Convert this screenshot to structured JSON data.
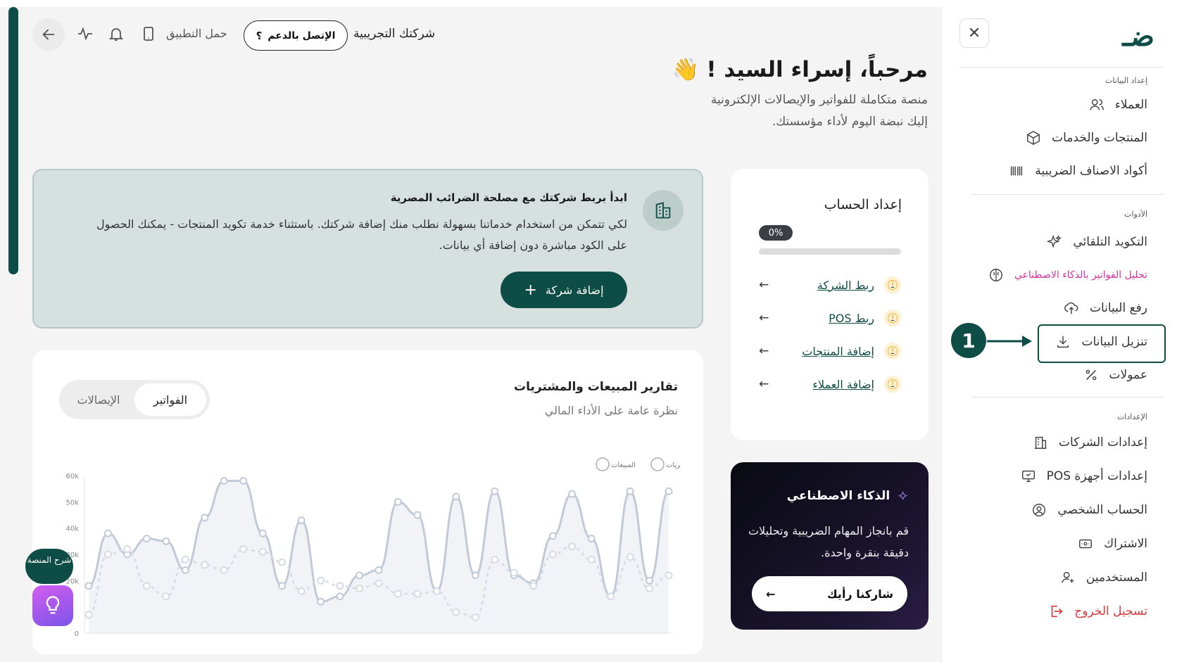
{
  "topbar": {
    "app_label": "حمل التطبيق",
    "support_label": "الإتصل بالدعم",
    "company_name": "شركتك التجريبية"
  },
  "greeting": {
    "title": "مرحباً، إسراء السيد !",
    "emoji": "👋",
    "line1": "منصة متكاملة للفواتير والإيصالات الإلكترونية",
    "line2": "إليك نبضة اليوم لأداء مؤسستك."
  },
  "setup": {
    "title": "إعداد الحساب",
    "percent": "0%",
    "progress_value": 0,
    "items": [
      {
        "label": "ربط الشركة"
      },
      {
        "label": "ربط POS"
      },
      {
        "label": "إضافة المنتجات"
      },
      {
        "label": "إضافة العملاء"
      }
    ]
  },
  "banner": {
    "title": "ابدأ بربط شركتك مع مصلحة الضرائب المصرية",
    "text": "لكي تتمكن من استخدام خدماتنا بسهولة نطلب منك إضافة شركتك. باستثناء خدمة تكويد المنتجات - يمكنك الحصول على الكود مباشرة دون إضافة أي بيانات.",
    "button": "إضافة شركة"
  },
  "ai": {
    "title": "الذكاء الاصطناعي",
    "text": "قم بانجاز المهام الضريبية وتحليلات دقيقة بنقرة واحدة.",
    "button": "شاركنا رأيك"
  },
  "chart": {
    "title": "تقارير المبيعات والمشتريات",
    "subtitle": "نظرة عامة على الأداء المالي",
    "tabs": [
      "الفواتير",
      "الإيصالات"
    ],
    "active_tab": 0
  },
  "chart_data": {
    "type": "line",
    "ylim": [
      0,
      60000
    ],
    "yticks": [
      "60k",
      "50k",
      "40k",
      "30k",
      "20k",
      "0"
    ],
    "legend": [
      "المشتريات",
      "المبيعات"
    ],
    "series": [
      {
        "name": "المبيعات",
        "values": [
          18000,
          38000,
          30000,
          36000,
          35000,
          24000,
          44000,
          58000,
          58000,
          38000,
          18000,
          43000,
          12000,
          14000,
          22000,
          24000,
          50000,
          45000,
          16000,
          52000,
          22000,
          54000,
          22000,
          19000,
          37000,
          53000,
          36000,
          14000,
          54000,
          20000,
          54000
        ]
      },
      {
        "name": "المشتريات",
        "values": [
          7000,
          30000,
          32000,
          18000,
          14000,
          28000,
          26000,
          24000,
          32000,
          31000,
          27000,
          16000,
          20000,
          18000,
          17000,
          19000,
          15000,
          15000,
          16000,
          8000,
          6000,
          28000,
          23000,
          18000,
          30000,
          33000,
          28000,
          14000,
          29000,
          17000,
          22000
        ]
      }
    ]
  },
  "help": {
    "label": "شرح المنصة"
  },
  "sidebar": {
    "logo": "ضـ",
    "section_data": "إعداد البيانات",
    "section_tools": "الأدوات",
    "section_settings": "الإعدادات",
    "items": [
      {
        "label": "العملاء",
        "icon": "users-icon"
      },
      {
        "label": "المنتجات والخدمات",
        "icon": "box-icon"
      },
      {
        "label": "أكواد الاصناف الضريبية",
        "icon": "barcode-icon"
      },
      {
        "label": "التكويد التلقائي",
        "icon": "sparkle-icon"
      },
      {
        "label": "تحليل الفواتير بالذكاء الاصطناعي",
        "icon": "brain-icon"
      },
      {
        "label": "رفع البيانات",
        "icon": "upload-icon"
      },
      {
        "label": "تنزيل البيانات",
        "icon": "download-icon"
      },
      {
        "label": "عمولات",
        "icon": "percent-icon"
      },
      {
        "label": "إعدادات الشركات",
        "icon": "building-icon"
      },
      {
        "label": "إعدادات أجهزة POS",
        "icon": "monitor-icon"
      },
      {
        "label": "الحساب الشخصي",
        "icon": "user-circle-icon"
      },
      {
        "label": "الاشتراك",
        "icon": "card-icon"
      },
      {
        "label": "المستخدمين",
        "icon": "user-plus-icon"
      },
      {
        "label": "تسجيل الخروج",
        "icon": "logout-icon"
      }
    ]
  },
  "annotation": {
    "step": "1"
  },
  "colors": {
    "brand": "#0e4d45",
    "pink": "#d6309c",
    "danger": "#d23b3b"
  }
}
